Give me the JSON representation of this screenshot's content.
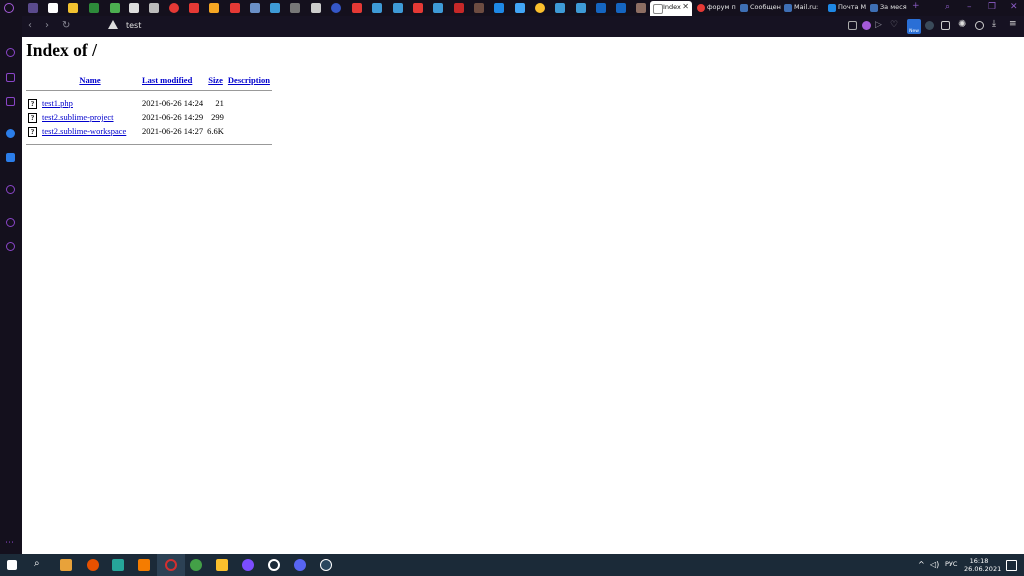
{
  "browser": {
    "tabs": [
      {
        "label": "Index",
        "active": true
      },
      {
        "label": "форум п",
        "active": false
      },
      {
        "label": "Сообщен",
        "active": false
      },
      {
        "label": "Mail.ru:",
        "active": false
      },
      {
        "label": "Почта М",
        "active": false
      },
      {
        "label": "За меся",
        "active": false
      }
    ],
    "address": "test",
    "new_badge": "New"
  },
  "page": {
    "title": "Index of /",
    "columns": [
      "Name",
      "Last modified",
      "Size",
      "Description"
    ],
    "rows": [
      {
        "icon": "?",
        "name": "test1.php",
        "modified": "2021-06-26 14:24",
        "size": "21",
        "description": ""
      },
      {
        "icon": "?",
        "name": "test2.sublime-project",
        "modified": "2021-06-26 14:29",
        "size": "299",
        "description": ""
      },
      {
        "icon": "?",
        "name": "test2.sublime-workspace",
        "modified": "2021-06-26 14:27",
        "size": "6.6K",
        "description": ""
      }
    ]
  },
  "taskbar": {
    "language": "РУС",
    "time": "16:18",
    "date": "26.06.2021"
  },
  "colors": {
    "accent": "#8a45c8",
    "link": "#0000cc",
    "chrome_bg": "#14101d",
    "taskbar_bg": "#1b2a38"
  }
}
